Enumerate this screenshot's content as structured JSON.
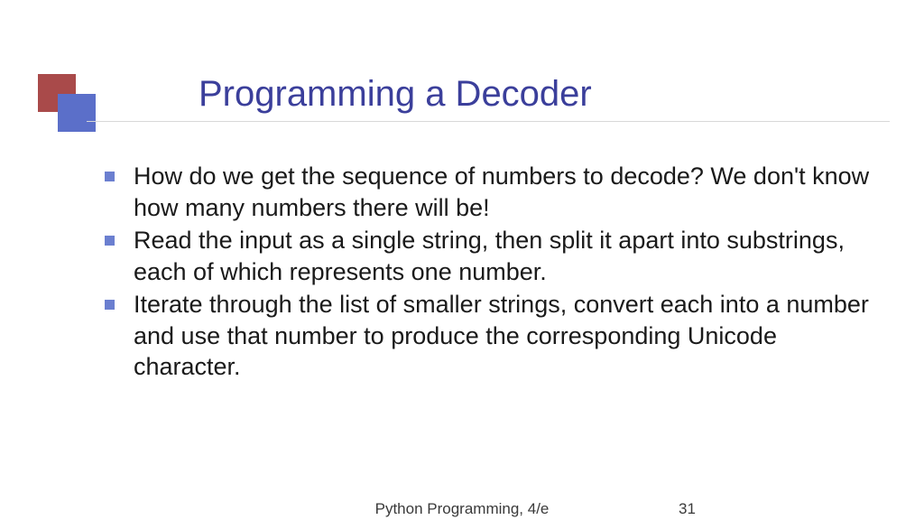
{
  "slide": {
    "title": "Programming a Decoder",
    "bullets": [
      "How do we get the sequence of numbers to decode? We don't know how many numbers there will be!",
      "Read the input as a single string, then split it apart into substrings, each of which represents one number.",
      "Iterate through the list of smaller strings, convert each into a number and use that number to produce the corresponding Unicode character."
    ]
  },
  "footer": {
    "source": "Python Programming, 4/e",
    "page": "31"
  }
}
